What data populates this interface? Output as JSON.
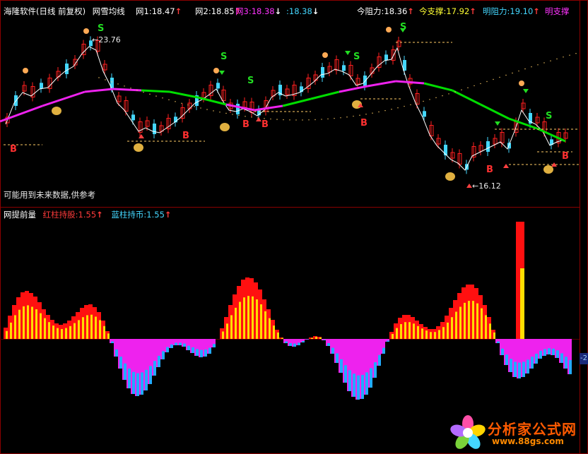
{
  "header_top": {
    "title": "海隆软件(日线 前复权)",
    "indicator_name": "网雪均线",
    "items": [
      {
        "label": "网1:18.47",
        "color": "#ffffff",
        "arrow": "↑"
      },
      {
        "label": "网2:18.85",
        "color": "#ffffff",
        "arrow": "↑"
      },
      {
        "label": "网3:18.38",
        "color": "#ff33ff",
        "arrow": "↓"
      },
      {
        "label": ":18.38",
        "color": "#44d7ff",
        "arrow": "↓"
      },
      {
        "label": "今阻力:18.36",
        "color": "#ffffff",
        "arrow": "↑"
      },
      {
        "label": "今支撑:17.92",
        "color": "#ffff33",
        "arrow": "↑"
      },
      {
        "label": "明阻力:19.10",
        "color": "#44d7ff",
        "arrow": "↑"
      },
      {
        "label": "明支撑",
        "color": "#ff33ff",
        "arrow": ""
      }
    ]
  },
  "price_panel": {
    "high_label": "23.76",
    "low_label": "16.12",
    "note": "可能用到未来数据,供参考",
    "signal_buy": "B",
    "signal_sell": "S"
  },
  "header_bottom": {
    "name": "网提前量",
    "item1": "红柱持股:1.55",
    "item2": "蓝柱持币:1.55",
    "arrow": "↑"
  },
  "volume_panel": {
    "right_axis_label": "-2"
  },
  "logo": {
    "title": "分析家公式网",
    "url": "www.88gs.com"
  },
  "colors": {
    "ma_trend_up": "#00dd00",
    "ma_trend_down": "#ee22ee",
    "bull_candle": "#ff2020",
    "bear_candle": "#44d7ff",
    "hist_pos_1": "#ff1010",
    "hist_pos_2": "#ffdd00",
    "hist_neg_1": "#ee22ee",
    "hist_neg_2": "#22aaff",
    "panel_border": "#8a0000"
  }
}
